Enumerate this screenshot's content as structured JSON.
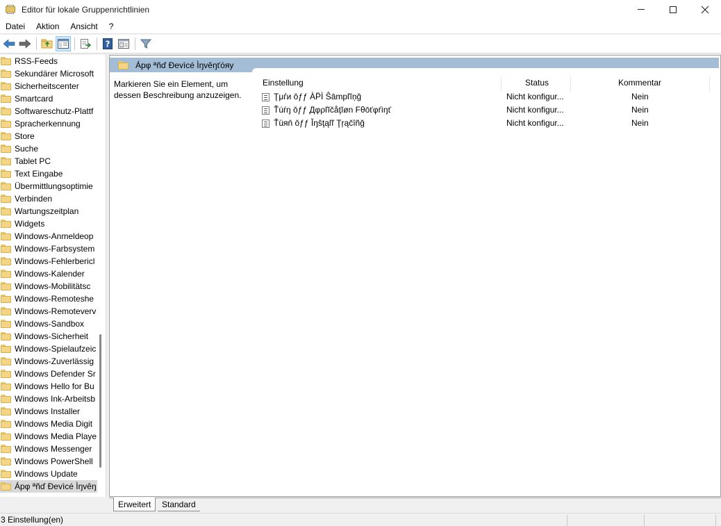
{
  "window": {
    "title": "Editor für lokale Gruppenrichtlinien"
  },
  "menu": [
    "Datei",
    "Aktion",
    "Ansicht",
    "?"
  ],
  "toolbar": {
    "buttons": [
      "back-arrow-icon",
      "forward-arrow-icon",
      "up-folder-icon",
      "show-hide-tree-icon",
      "export-list-icon",
      "help-icon",
      "properties-icon",
      "filter-icon"
    ]
  },
  "tree": {
    "items": [
      "RSS-Feeds",
      "Sekundärer Microsoft",
      "Sicherheitscenter",
      "Smartcard",
      "Softwareschutz-Plattf",
      "Spracherkennung",
      "Store",
      "Suche",
      "Tablet PC",
      "Text Eingabe",
      "Übermittlungsoptimie",
      "Verbinden",
      "Wartungszeitplan",
      "Widgets",
      "Windows-Anmeldeop",
      "Windows-Farbsystem",
      "Windows-Fehlerbericl",
      "Windows-Kalender",
      "Windows-Mobilitätsc",
      "Windows-Remoteshe",
      "Windows-Remoteverv",
      "Windows-Sandbox",
      "Windows-Sicherheit",
      "Windows-Spielaufzeic",
      "Windows-Zuverlässig",
      "Windows Defender Sr",
      "Windows Hello for Bu",
      "Windows Ink-Arbeitsb",
      "Windows Installer",
      "Windows Media Digit",
      "Windows Media Playe",
      "Windows Messenger",
      "Windows PowerShell",
      "Windows Update",
      "Ápφ ªñď Ðevìcé Ìŋvêŋ"
    ],
    "selected_index": 34
  },
  "pane": {
    "header_title": "Ápφ ªñď Ðevìcé Ìŋvêŋťóяy",
    "description": "Markieren Sie ein Element, um dessen Beschreibung anzuzeigen.",
    "columns": {
      "setting": "Einstellung",
      "status": "Status",
      "comment": "Kommentar"
    },
    "rows": [
      {
        "setting": "Ţμѓи ǒƒƒ ÀP̈Ì Ŝāmpľĭņğ",
        "status": "Nicht konfigur...",
        "comment": "Nein"
      },
      {
        "setting": "Ťúŕŋ ǒƒƒ Дφρľĭčåţĭøn Fθōťφŕìŋť",
        "status": "Nicht konfigur...",
        "comment": "Nein"
      },
      {
        "setting": "Ťüяň ǒƒƒ Ĭŋŝţąľľ Ţŗąčîñğ",
        "status": "Nicht konfigur...",
        "comment": "Nein"
      }
    ]
  },
  "tabs": [
    "Erweitert",
    "Standard"
  ],
  "status": {
    "text": "3 Einstellung(en)"
  }
}
